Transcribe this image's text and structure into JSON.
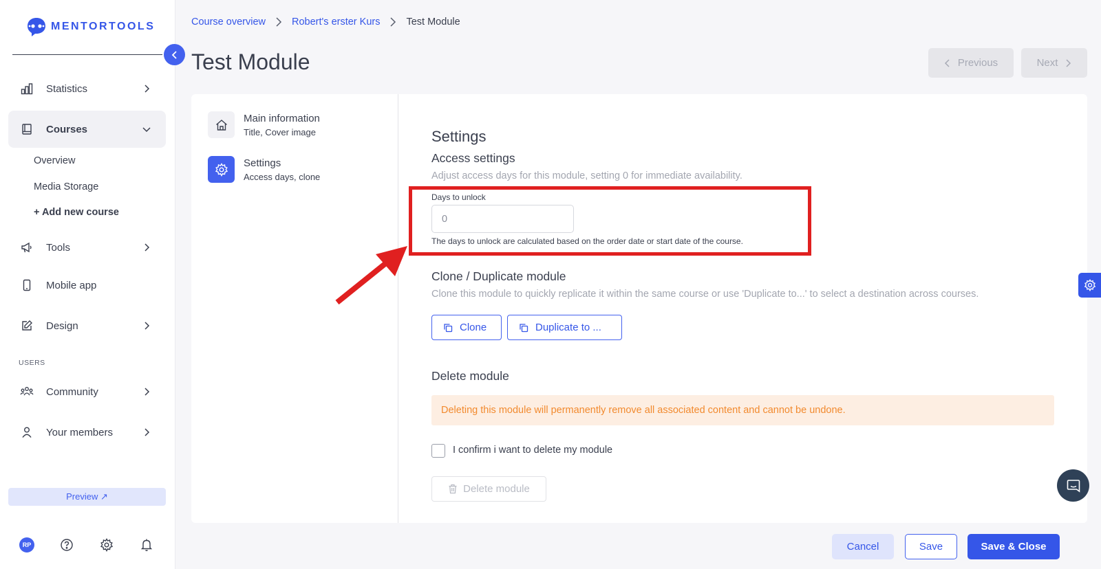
{
  "app": {
    "logo_text": "MENTORTOOLS"
  },
  "sidebar": {
    "items": [
      {
        "label": "Statistics",
        "icon": "bar-chart-icon"
      },
      {
        "label": "Courses",
        "icon": "book-icon"
      },
      {
        "label": "Tools",
        "icon": "megaphone-icon"
      },
      {
        "label": "Mobile app",
        "icon": "phone-icon"
      },
      {
        "label": "Design",
        "icon": "pencil-icon"
      },
      {
        "label": "Community",
        "icon": "people-icon"
      },
      {
        "label": "Your members",
        "icon": "user-icon"
      }
    ],
    "courses_sub": [
      "Overview",
      "Media Storage",
      "+ Add new course"
    ],
    "section_users": "USERS",
    "preview_label": "Preview ↗",
    "avatar_initials": "RP"
  },
  "breadcrumb": [
    "Course overview",
    "Robert's erster Kurs",
    "Test Module"
  ],
  "page_title": "Test Module",
  "pager": {
    "previous": "Previous",
    "next": "Next"
  },
  "steps": [
    {
      "title": "Main information",
      "subtitle": "Title, Cover image"
    },
    {
      "title": "Settings",
      "subtitle": "Access days, clone"
    }
  ],
  "settings": {
    "heading": "Settings",
    "access": {
      "heading": "Access settings",
      "description": "Adjust access days for this module, setting 0 for immediate availability.",
      "field_label": "Days to unlock",
      "field_value": "0",
      "field_help": "The days to unlock are calculated based on the order date or start date of the course."
    },
    "clone": {
      "heading": "Clone / Duplicate module",
      "description": "Clone this module to quickly replicate it within the same course or use 'Duplicate to...' to select a destination across courses.",
      "clone_label": "Clone",
      "duplicate_label": "Duplicate to ..."
    },
    "delete": {
      "heading": "Delete module",
      "warning": "Deleting this module will permanently remove all associated content and cannot be undone.",
      "confirm_label": "I confirm i want to delete my module",
      "button_label": "Delete module"
    }
  },
  "footer": {
    "cancel": "Cancel",
    "save": "Save",
    "save_close": "Save & Close"
  },
  "colors": {
    "accent": "#4361ee",
    "link": "#3556e8",
    "warning_bg": "#fdeee2",
    "warning_text": "#f28a2e",
    "highlight": "#e02020"
  }
}
